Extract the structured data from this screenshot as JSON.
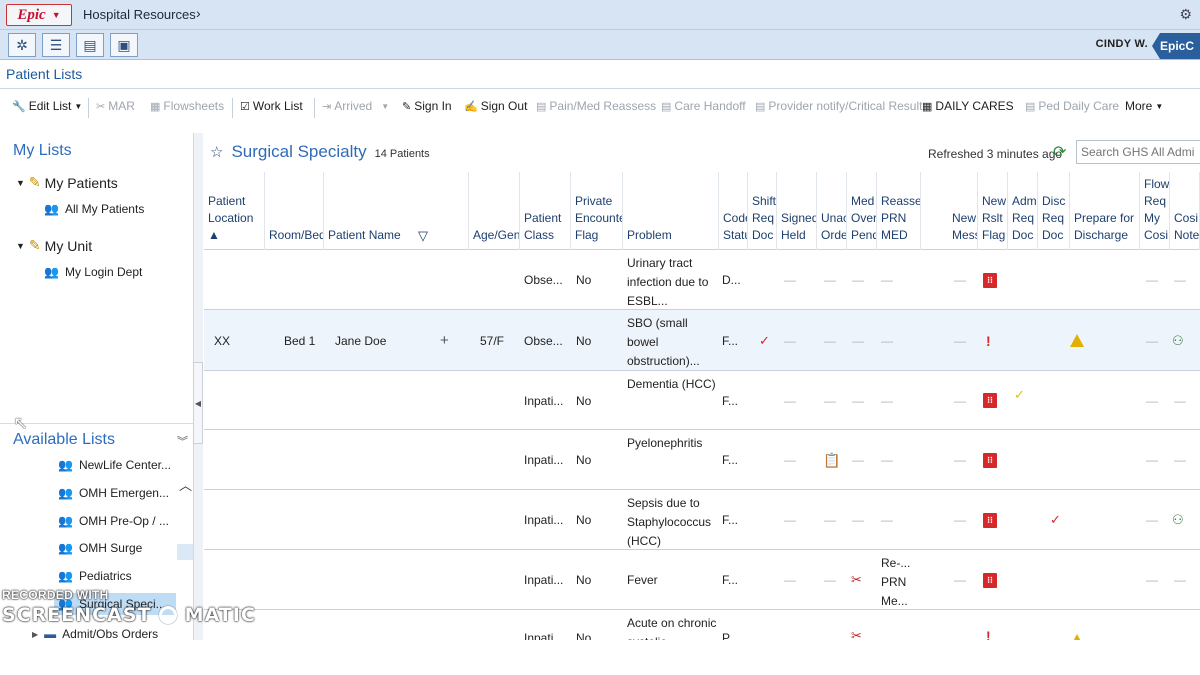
{
  "window": {
    "logo": "Epic",
    "title": "Hospital Resources",
    "user": "CINDY W.",
    "right_tab": "EpicC"
  },
  "activity": {
    "title": "Patient Lists"
  },
  "toolbar": {
    "items": [
      {
        "label": "Edit List",
        "enabled": true
      },
      {
        "label": "MAR",
        "enabled": false
      },
      {
        "label": "Flowsheets",
        "enabled": false
      },
      {
        "label": "Work List",
        "enabled": true
      },
      {
        "label": "Arrived",
        "enabled": false
      },
      {
        "label": "Sign In",
        "enabled": true
      },
      {
        "label": "Sign Out",
        "enabled": true
      },
      {
        "label": "Pain/Med Reassess",
        "enabled": false
      },
      {
        "label": "Care Handoff",
        "enabled": false
      },
      {
        "label": "Provider notify/Critical Result",
        "enabled": false
      },
      {
        "label": "DAILY CARES",
        "enabled": true
      },
      {
        "label": "Ped Daily Care",
        "enabled": false
      },
      {
        "label": "More",
        "enabled": true
      }
    ]
  },
  "sidebar": {
    "my_lists_heading": "My Lists",
    "groups": [
      {
        "label": "My Patients",
        "items": [
          "All My Patients"
        ]
      },
      {
        "label": "My Unit",
        "items": [
          "My Login Dept"
        ]
      }
    ],
    "available_heading": "Available Lists",
    "available_items": [
      "NewLife Center...",
      "OMH Emergen...",
      "OMH Pre-Op / ...",
      "OMH Surge",
      "Pediatrics",
      "Surgical Speci...",
      "Admit/Obs Orders"
    ]
  },
  "list": {
    "title": "Surgical Specialty",
    "count": "14 Patients",
    "refreshed": "Refreshed 3 minutes ago",
    "search_placeholder": "Search GHS All Admi"
  },
  "columns": [
    "Patient\nLocation ▲",
    "Room/Bed",
    "Patient Name",
    "Age/Gen",
    "Patient\nClass",
    "Private\nEncounter\nFlag",
    "Problem",
    "Code\nStatus",
    "Shift\nReq\nDoc",
    "Signed\nHeld",
    "Unack\nOrders",
    "Med\nOver\nPend",
    "Reasse\nPRN\nMED",
    "New\nMess",
    "New\nRslt\nFlag",
    "Adm\nReq\nDoc",
    "Disc\nReq\nDoc",
    "Prepare for\nDischarge",
    "Flow\nReq\nMy\nCosi",
    "Cosi\nNote"
  ],
  "rows": [
    {
      "location": "",
      "room": "",
      "name": "",
      "age": "",
      "class": "Obse...",
      "private": "No",
      "problem": "Urinary tract infection due to ESBL...",
      "code": "D...",
      "shift": "",
      "signed": "—",
      "unack": "—",
      "medover": "—",
      "reasse": "—",
      "newmess": "—",
      "rslt": "flag",
      "adm": "",
      "disc": "",
      "prepare": "",
      "flow": "—",
      "cosi": "—"
    },
    {
      "location": "XX",
      "room": "Bed 1",
      "name": "Jane Doe",
      "age": "57/F",
      "class": "Obse...",
      "private": "No",
      "problem": "SBO (small bowel obstruction)...",
      "code": "F...",
      "shift": "check",
      "signed": "—",
      "unack": "—",
      "medover": "—",
      "reasse": "—",
      "newmess": "—",
      "rslt": "!",
      "adm": "",
      "disc": "",
      "prepare": "warn",
      "flow": "—",
      "cosi": "cosign"
    },
    {
      "location": "",
      "room": "",
      "name": "",
      "age": "",
      "class": "Inpati...",
      "private": "No",
      "problem": "Dementia (HCC)",
      "code": "F...",
      "shift": "",
      "signed": "—",
      "unack": "—",
      "medover": "—",
      "reasse": "—",
      "newmess": "—",
      "rslt": "flag",
      "adm": "check-yellow",
      "disc": "",
      "prepare": "",
      "flow": "—",
      "cosi": "—"
    },
    {
      "location": "",
      "room": "",
      "name": "",
      "age": "",
      "class": "Inpati...",
      "private": "No",
      "problem": "Pyelonephritis",
      "code": "F...",
      "shift": "",
      "signed": "—",
      "unack": "orders",
      "medover": "—",
      "reasse": "—",
      "newmess": "—",
      "rslt": "flag",
      "adm": "",
      "disc": "",
      "prepare": "",
      "flow": "—",
      "cosi": "—"
    },
    {
      "location": "",
      "room": "",
      "name": "",
      "age": "",
      "class": "Inpati...",
      "private": "No",
      "problem": "Sepsis due to Staphylococcus (HCC)",
      "code": "F...",
      "shift": "",
      "signed": "—",
      "unack": "—",
      "medover": "—",
      "reasse": "—",
      "newmess": "—",
      "rslt": "flag",
      "adm": "",
      "disc": "check",
      "prepare": "",
      "flow": "—",
      "cosi": "cosign"
    },
    {
      "location": "",
      "room": "",
      "name": "",
      "age": "",
      "class": "Inpati...",
      "private": "No",
      "problem": "Fever",
      "code": "F...",
      "shift": "",
      "signed": "—",
      "unack": "—",
      "medover": "med",
      "reasse": "Re-... PRN Me...",
      "newmess": "—",
      "rslt": "flag",
      "adm": "",
      "disc": "",
      "prepare": "",
      "flow": "—",
      "cosi": "—"
    },
    {
      "location": "",
      "room": "",
      "name": "",
      "age": "",
      "class": "Inpati...",
      "private": "No",
      "problem": "Acute on chronic systolic...",
      "code": "P...",
      "shift": "",
      "signed": "",
      "unack": "",
      "medover": "med",
      "reasse": "",
      "newmess": "",
      "rslt": "!",
      "adm": "",
      "disc": "",
      "prepare": "warn",
      "flow": "",
      "cosi": ""
    }
  ],
  "watermark": {
    "line1": "RECORDED WITH",
    "line2": "SCREENCAST",
    "line3": "MATIC"
  }
}
